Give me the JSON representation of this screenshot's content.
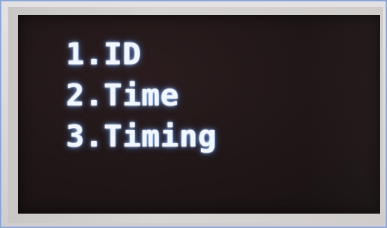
{
  "menu": {
    "items": [
      {
        "label": "1.ID"
      },
      {
        "label": "2.Time"
      },
      {
        "label": "3.Timing"
      }
    ]
  },
  "colors": {
    "screen_background": "#1f1617",
    "text": "#f2f6ff",
    "text_glow": "#8cbeff",
    "bezel": "#d7d5d3",
    "frame_border": "#8aa7d6"
  }
}
